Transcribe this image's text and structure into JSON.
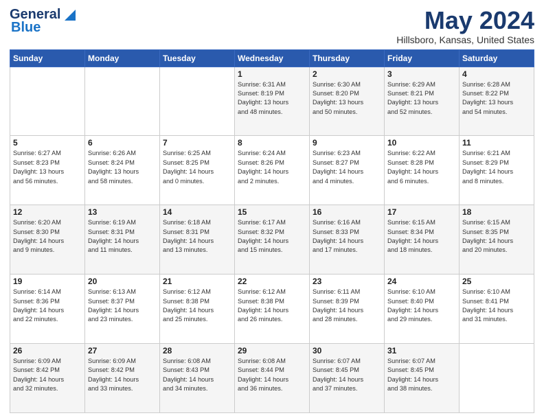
{
  "header": {
    "logo_line1": "General",
    "logo_line2": "Blue",
    "month_title": "May 2024",
    "location": "Hillsboro, Kansas, United States"
  },
  "weekdays": [
    "Sunday",
    "Monday",
    "Tuesday",
    "Wednesday",
    "Thursday",
    "Friday",
    "Saturday"
  ],
  "weeks": [
    [
      {
        "day": "",
        "info": ""
      },
      {
        "day": "",
        "info": ""
      },
      {
        "day": "",
        "info": ""
      },
      {
        "day": "1",
        "info": "Sunrise: 6:31 AM\nSunset: 8:19 PM\nDaylight: 13 hours\nand 48 minutes."
      },
      {
        "day": "2",
        "info": "Sunrise: 6:30 AM\nSunset: 8:20 PM\nDaylight: 13 hours\nand 50 minutes."
      },
      {
        "day": "3",
        "info": "Sunrise: 6:29 AM\nSunset: 8:21 PM\nDaylight: 13 hours\nand 52 minutes."
      },
      {
        "day": "4",
        "info": "Sunrise: 6:28 AM\nSunset: 8:22 PM\nDaylight: 13 hours\nand 54 minutes."
      }
    ],
    [
      {
        "day": "5",
        "info": "Sunrise: 6:27 AM\nSunset: 8:23 PM\nDaylight: 13 hours\nand 56 minutes."
      },
      {
        "day": "6",
        "info": "Sunrise: 6:26 AM\nSunset: 8:24 PM\nDaylight: 13 hours\nand 58 minutes."
      },
      {
        "day": "7",
        "info": "Sunrise: 6:25 AM\nSunset: 8:25 PM\nDaylight: 14 hours\nand 0 minutes."
      },
      {
        "day": "8",
        "info": "Sunrise: 6:24 AM\nSunset: 8:26 PM\nDaylight: 14 hours\nand 2 minutes."
      },
      {
        "day": "9",
        "info": "Sunrise: 6:23 AM\nSunset: 8:27 PM\nDaylight: 14 hours\nand 4 minutes."
      },
      {
        "day": "10",
        "info": "Sunrise: 6:22 AM\nSunset: 8:28 PM\nDaylight: 14 hours\nand 6 minutes."
      },
      {
        "day": "11",
        "info": "Sunrise: 6:21 AM\nSunset: 8:29 PM\nDaylight: 14 hours\nand 8 minutes."
      }
    ],
    [
      {
        "day": "12",
        "info": "Sunrise: 6:20 AM\nSunset: 8:30 PM\nDaylight: 14 hours\nand 9 minutes."
      },
      {
        "day": "13",
        "info": "Sunrise: 6:19 AM\nSunset: 8:31 PM\nDaylight: 14 hours\nand 11 minutes."
      },
      {
        "day": "14",
        "info": "Sunrise: 6:18 AM\nSunset: 8:31 PM\nDaylight: 14 hours\nand 13 minutes."
      },
      {
        "day": "15",
        "info": "Sunrise: 6:17 AM\nSunset: 8:32 PM\nDaylight: 14 hours\nand 15 minutes."
      },
      {
        "day": "16",
        "info": "Sunrise: 6:16 AM\nSunset: 8:33 PM\nDaylight: 14 hours\nand 17 minutes."
      },
      {
        "day": "17",
        "info": "Sunrise: 6:15 AM\nSunset: 8:34 PM\nDaylight: 14 hours\nand 18 minutes."
      },
      {
        "day": "18",
        "info": "Sunrise: 6:15 AM\nSunset: 8:35 PM\nDaylight: 14 hours\nand 20 minutes."
      }
    ],
    [
      {
        "day": "19",
        "info": "Sunrise: 6:14 AM\nSunset: 8:36 PM\nDaylight: 14 hours\nand 22 minutes."
      },
      {
        "day": "20",
        "info": "Sunrise: 6:13 AM\nSunset: 8:37 PM\nDaylight: 14 hours\nand 23 minutes."
      },
      {
        "day": "21",
        "info": "Sunrise: 6:12 AM\nSunset: 8:38 PM\nDaylight: 14 hours\nand 25 minutes."
      },
      {
        "day": "22",
        "info": "Sunrise: 6:12 AM\nSunset: 8:38 PM\nDaylight: 14 hours\nand 26 minutes."
      },
      {
        "day": "23",
        "info": "Sunrise: 6:11 AM\nSunset: 8:39 PM\nDaylight: 14 hours\nand 28 minutes."
      },
      {
        "day": "24",
        "info": "Sunrise: 6:10 AM\nSunset: 8:40 PM\nDaylight: 14 hours\nand 29 minutes."
      },
      {
        "day": "25",
        "info": "Sunrise: 6:10 AM\nSunset: 8:41 PM\nDaylight: 14 hours\nand 31 minutes."
      }
    ],
    [
      {
        "day": "26",
        "info": "Sunrise: 6:09 AM\nSunset: 8:42 PM\nDaylight: 14 hours\nand 32 minutes."
      },
      {
        "day": "27",
        "info": "Sunrise: 6:09 AM\nSunset: 8:42 PM\nDaylight: 14 hours\nand 33 minutes."
      },
      {
        "day": "28",
        "info": "Sunrise: 6:08 AM\nSunset: 8:43 PM\nDaylight: 14 hours\nand 34 minutes."
      },
      {
        "day": "29",
        "info": "Sunrise: 6:08 AM\nSunset: 8:44 PM\nDaylight: 14 hours\nand 36 minutes."
      },
      {
        "day": "30",
        "info": "Sunrise: 6:07 AM\nSunset: 8:45 PM\nDaylight: 14 hours\nand 37 minutes."
      },
      {
        "day": "31",
        "info": "Sunrise: 6:07 AM\nSunset: 8:45 PM\nDaylight: 14 hours\nand 38 minutes."
      },
      {
        "day": "",
        "info": ""
      }
    ]
  ]
}
